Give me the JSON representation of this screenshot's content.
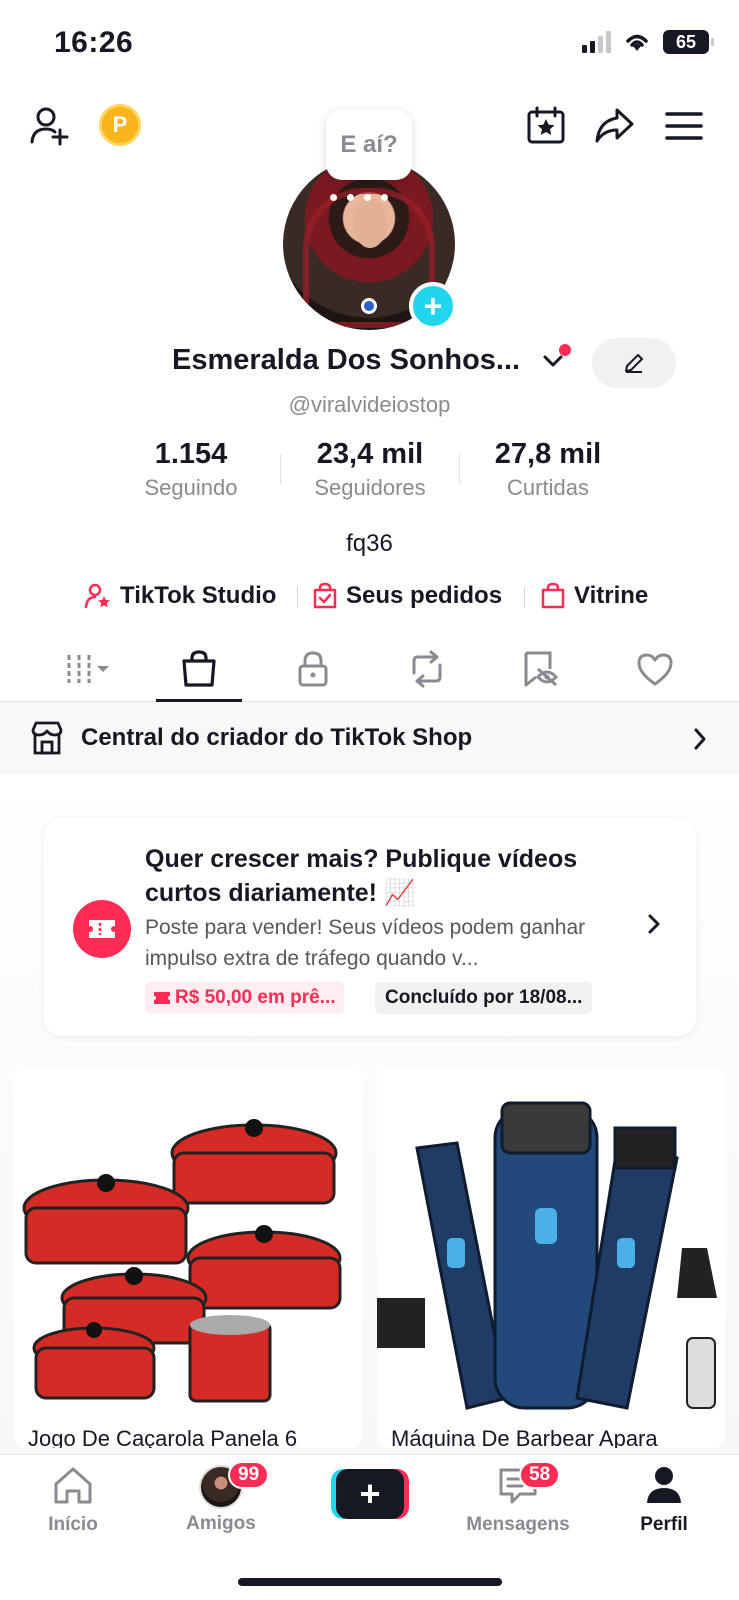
{
  "status_bar": {
    "time": "16:26",
    "battery": "65"
  },
  "profile": {
    "bubble_text": "E aí?",
    "display_name": "Esmeralda Dos Sonhos...",
    "username": "@viralvideiostop",
    "coin_label": "P",
    "stats": [
      {
        "value": "1.154",
        "label": "Seguindo"
      },
      {
        "value": "23,4 mil",
        "label": "Seguidores"
      },
      {
        "value": "27,8 mil",
        "label": "Curtidas"
      }
    ],
    "bio": "fq36",
    "links": [
      {
        "label": "TikTok Studio"
      },
      {
        "label": "Seus pedidos"
      },
      {
        "label": "Vitrine"
      }
    ]
  },
  "shop_center": {
    "label": "Central do criador do TikTok Shop"
  },
  "promo": {
    "title": "Quer crescer mais? Publique vídeos curtos diariamente! 📈",
    "description": "Poste para vender! Seus vídeos podem ganhar impulso extra de tráfego quando v...",
    "reward_tag": "R$ 50,00 em prê...",
    "deadline_tag": "Concluído por 18/08..."
  },
  "products": [
    {
      "title": "Jogo De Caçarola Panela 6"
    },
    {
      "title": "Máquina De Barbear Apara"
    }
  ],
  "bottom_nav": {
    "items": [
      {
        "label": "Início"
      },
      {
        "label": "Amigos",
        "badge": "99"
      },
      {
        "label": "Mensagens",
        "badge": "58"
      },
      {
        "label": "Perfil"
      }
    ]
  },
  "colors": {
    "accent": "#fe2c55",
    "cyan": "#20d5ec",
    "text": "#161823",
    "muted": "#8a8b91"
  }
}
